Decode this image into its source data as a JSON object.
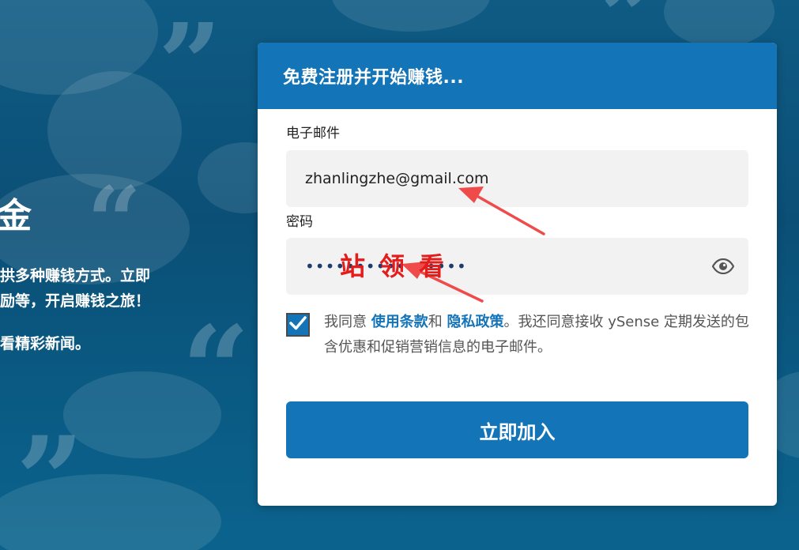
{
  "background_text": {
    "heading_fragment": "金",
    "line1": "拱多种赚钱方式。立即",
    "line2": "励等，开启赚钱之旅！",
    "line3": "看精彩新闻。"
  },
  "card": {
    "title": "免费注册并开始赚钱...",
    "email": {
      "label": "电子邮件",
      "value": "zhanlingzhe@gmail.com"
    },
    "password": {
      "label": "密码",
      "masked_value": "••••••••••••••••"
    },
    "consent": {
      "checked": true,
      "prefix": "我同意 ",
      "terms_link": "使用条款",
      "and": "和 ",
      "privacy_link": "隐私政策",
      "suffix": "。我还同意接收 ySense 定期发送的包含优惠和促销营销信息的电子邮件。"
    },
    "submit_label": "立即加入"
  },
  "annotation": {
    "watermark_text": "站领看"
  },
  "colors": {
    "accent": "#1474b8",
    "annotation": "#e31c1c",
    "background": "#0f5b84"
  },
  "icons": {
    "password_toggle": "eye-icon",
    "checkbox": "checkmark-icon"
  }
}
